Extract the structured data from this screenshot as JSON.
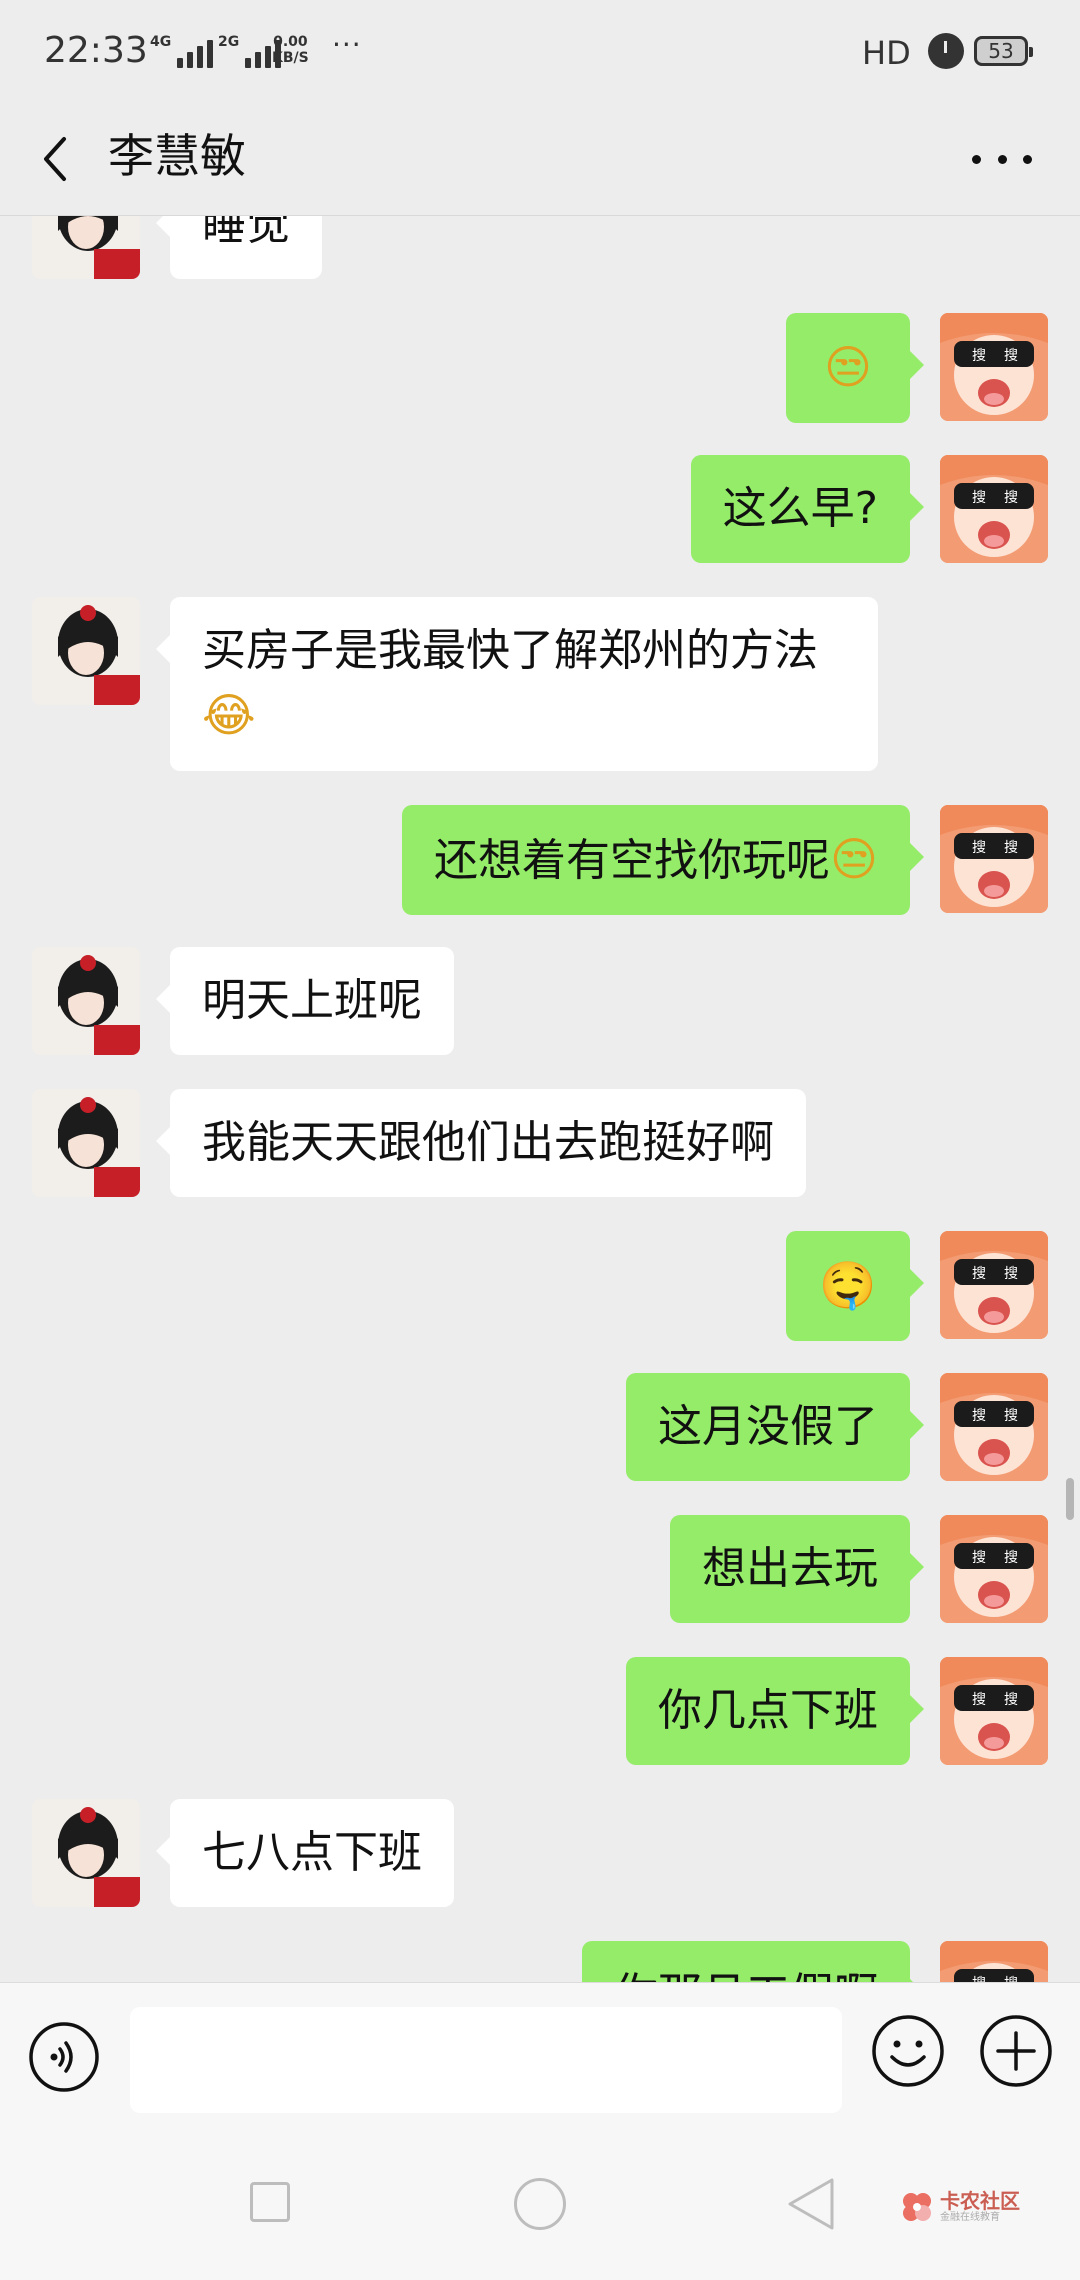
{
  "status_bar": {
    "time": "22:33",
    "signal_1_network": "4G",
    "signal_2_network": "2G",
    "speed_value": "0.00",
    "speed_unit": "KB/S",
    "more": "···",
    "hd": "HD",
    "battery": "53"
  },
  "header": {
    "title": "李慧敏"
  },
  "messages": [
    {
      "side": "left",
      "text": "睡觉"
    },
    {
      "side": "right",
      "text": "",
      "emoji": "😒"
    },
    {
      "side": "right",
      "text": "这么早?"
    },
    {
      "side": "left",
      "text": "买房子是我最快了解郑州的方法",
      "emoji": "😂"
    },
    {
      "side": "right",
      "text": "还想着有空找你玩呢",
      "emoji": "😒"
    },
    {
      "side": "left",
      "text": "明天上班呢"
    },
    {
      "side": "left",
      "text": "我能天天跟他们出去跑挺好啊"
    },
    {
      "side": "right",
      "text": "",
      "emoji": "🤤"
    },
    {
      "side": "right",
      "text": "这月没假了"
    },
    {
      "side": "right",
      "text": "想出去玩"
    },
    {
      "side": "right",
      "text": "你几点下班"
    },
    {
      "side": "left",
      "text": "七八点下班"
    },
    {
      "side": "right",
      "text": "你那月工假啊"
    }
  ],
  "input_bar": {
    "input_value": ""
  },
  "watermark": {
    "title": "卡农社区",
    "subtitle": "金融在线教育"
  },
  "colors": {
    "background": "#ededed",
    "my_bubble": "#95ec69",
    "their_bubble": "#ffffff"
  },
  "icons": {
    "back": "back-arrow-icon",
    "more": "more-dots-icon",
    "voice": "voice-icon",
    "emoji": "emoji-icon",
    "plus": "plus-icon"
  }
}
